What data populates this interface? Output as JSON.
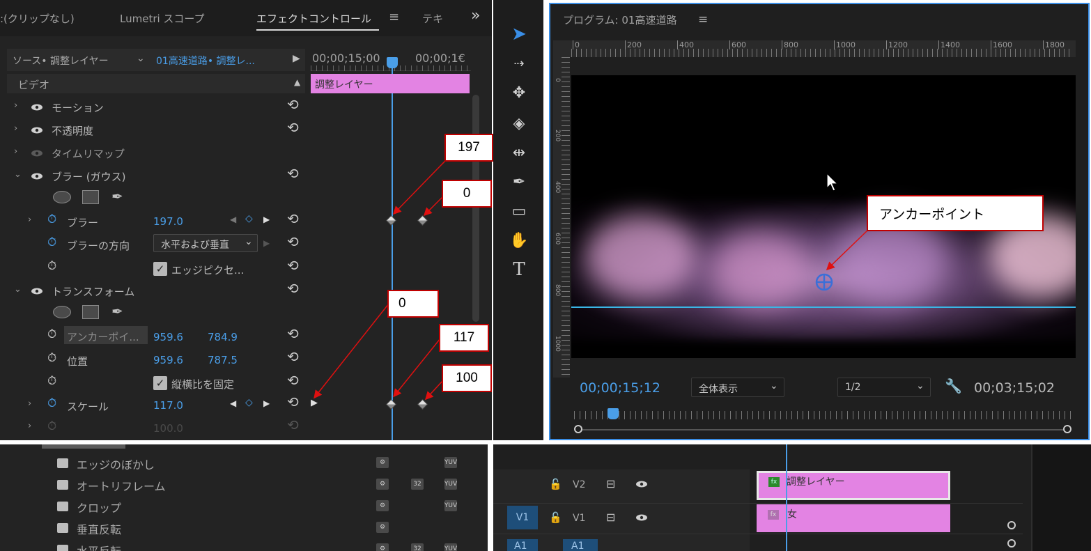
{
  "effect_panel": {
    "tabs": [
      {
        "label": ":(クリップなし)"
      },
      {
        "label": "Lumetri スコープ"
      },
      {
        "label": "エフェクトコントロール"
      },
      {
        "label": "テキ"
      }
    ],
    "overflow": "»",
    "source_label": "ソース• 調整レイヤー",
    "sequence_label": "01高速道路• 調整レ...",
    "timecode_left": "00;00;15;00",
    "timecode_right": "00;00;1€",
    "video_header": "ビデオ",
    "clip_bar_label": "調整レイヤー",
    "rows": {
      "motion": "モーション",
      "opacity": "不透明度",
      "time_remap": "タイムリマップ",
      "blur_group": "ブラー (ガウス)",
      "blur": "ブラー",
      "blur_value": "197.0",
      "blur_direction": "ブラーの方向",
      "blur_direction_value": "水平および垂直",
      "edge_pixels": "エッジピクセ...",
      "transform": "トランスフォーム",
      "anchor": "アンカーポイ...",
      "anchor_x": "959.6",
      "anchor_y": "784.9",
      "position": "位置",
      "position_x": "959.6",
      "position_y": "787.5",
      "lock_aspect": "縦横比を固定",
      "scale": "スケール",
      "scale_value": "117.0",
      "next_value": "100.0"
    }
  },
  "callouts": {
    "c197": "197",
    "c0a": "0",
    "c0b": "0",
    "c117": "117",
    "c100": "100",
    "anchor": "アンカーポイント"
  },
  "program_monitor": {
    "title": "プログラム: 01高速道路",
    "ruler": [
      "0",
      "200",
      "400",
      "600",
      "800",
      "1000",
      "1200",
      "1400",
      "1600",
      "1800"
    ],
    "vruler": [
      "0",
      "200",
      "400",
      "600",
      "800",
      "1000"
    ],
    "timecode": "00;00;15;12",
    "zoom": "全体表示",
    "resolution": "1/2",
    "duration": "00;03;15;02"
  },
  "effects_list": {
    "items": [
      "エッジのぼかし",
      "オートリフレーム",
      "クロップ",
      "垂直反転",
      "水平反転"
    ],
    "badges": [
      "32",
      "YUV"
    ]
  },
  "timeline": {
    "v2_label": "V2",
    "v1_label": "V1",
    "v1_source": "V1",
    "a1_label": "A1",
    "clip_v2": "調整レイヤー",
    "clip_v1": "女",
    "fx_label": "fx"
  },
  "colors": {
    "panel_bg": "#232323",
    "accent_blue": "#4a9ee8",
    "clip_pink": "#e383e3",
    "callout_red": "#c00000"
  }
}
